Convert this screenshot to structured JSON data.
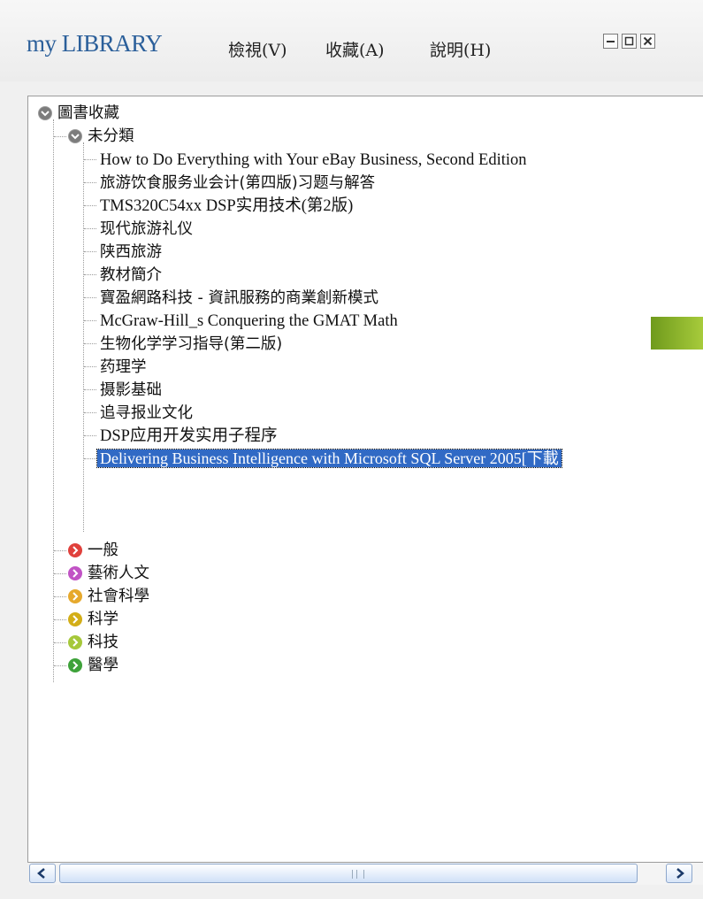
{
  "app_title": "my LIBRARY",
  "menu": [
    {
      "label": "檢視(V)"
    },
    {
      "label": "收藏(A)"
    },
    {
      "label": "說明(H)"
    }
  ],
  "window_controls": {
    "minimize_icon": "minimize-icon",
    "maximize_icon": "maximize-icon",
    "close_icon": "close-icon"
  },
  "tree": {
    "root": {
      "label": "圖書收藏",
      "icon": "collapse-icon"
    },
    "uncategorized": {
      "label": "未分類",
      "icon": "collapse-icon"
    },
    "books": [
      "How to Do Everything with Your eBay Business, Second Edition",
      "旅游饮食服务业会计(第四版)习题与解答",
      "TMS320C54xx DSP实用技术(第2版)",
      "现代旅游礼仪",
      "陕西旅游",
      "教材簡介",
      "寶盈網路科技 - 資訊服務的商業創新模式",
      "McGraw-Hill_s Conquering the GMAT Math",
      "生物化学学习指导(第二版)",
      "药理学",
      "摄影基础",
      "追寻报业文化",
      "DSP应用开发实用子程序",
      "Delivering Business Intelligence with Microsoft SQL Server 2005[下載"
    ],
    "selected_index": 13,
    "categories": [
      {
        "label": "一般",
        "color": "#e0413c"
      },
      {
        "label": "藝術人文",
        "color": "#c153c5"
      },
      {
        "label": "社會科學",
        "color": "#e6a92d"
      },
      {
        "label": "科学",
        "color": "#d3ae18"
      },
      {
        "label": "科技",
        "color": "#a6c83a"
      },
      {
        "label": "醫學",
        "color": "#3ea23a"
      }
    ]
  },
  "scrollbar": {
    "left_arrow": "arrow-left-icon",
    "right_arrow": "arrow-right-icon"
  }
}
